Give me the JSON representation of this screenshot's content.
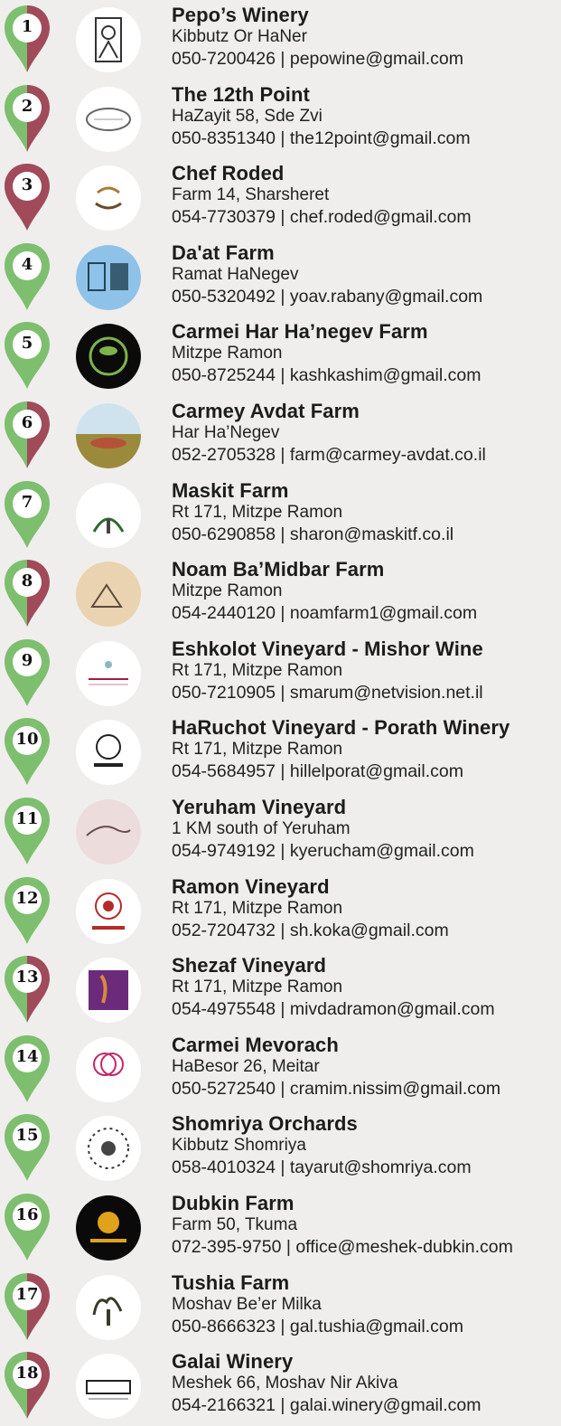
{
  "colors": {
    "pin_green": "#7dbf6e",
    "pin_red": "#a04a5a",
    "background": "#efeeec"
  },
  "entries": [
    {
      "number": "1",
      "name": "Pepo’s Winery",
      "address": "Kibbutz Or HaNer",
      "contact": "050-7200426 | pepowine@gmail.com",
      "pin": "split",
      "logo_icon": "pepos-winery-logo-icon"
    },
    {
      "number": "2",
      "name": "The 12th Point",
      "address": "HaZayit 58, Sde Zvi",
      "contact": "050-8351340 | the12point@gmail.com",
      "pin": "split",
      "logo_icon": "the-12th-point-logo-icon"
    },
    {
      "number": "3",
      "name": "Chef Roded",
      "address": "Farm 14, Sharsheret",
      "contact": "054-7730379 | chef.roded@gmail.com",
      "pin": "red",
      "logo_icon": "chef-roded-logo-icon"
    },
    {
      "number": "4",
      "name": "Da'at Farm",
      "address": "Ramat HaNegev",
      "contact": "050-5320492 | yoav.rabany@gmail.com",
      "pin": "green",
      "logo_icon": "daat-farm-logo-icon"
    },
    {
      "number": "5",
      "name": "Carmei Har Ha’negev Farm",
      "address": "Mitzpe Ramon",
      "contact": "050-8725244 | kashkashim@gmail.com",
      "pin": "green",
      "logo_icon": "carmei-har-hanegev-logo-icon"
    },
    {
      "number": "6",
      "name": "Carmey Avdat Farm",
      "address": "Har Ha’Negev",
      "contact": "052-2705328 | farm@carmey-avdat.co.il",
      "pin": "split",
      "logo_icon": "carmey-avdat-logo-icon"
    },
    {
      "number": "7",
      "name": "Maskit Farm",
      "address": "Rt 171, Mitzpe Ramon",
      "contact": "050-6290858 | sharon@maskitf.co.il",
      "pin": "green",
      "logo_icon": "maskit-farm-logo-icon"
    },
    {
      "number": "8",
      "name": "Noam Ba’Midbar Farm",
      "address": "Mitzpe Ramon",
      "contact": "054-2440120 | noamfarm1@gmail.com",
      "pin": "split",
      "logo_icon": "noam-bamidbar-logo-icon"
    },
    {
      "number": "9",
      "name": "Eshkolot Vineyard - Mishor Wine",
      "address": "Rt 171, Mitzpe Ramon",
      "contact": "050-7210905 | smarum@netvision.net.il",
      "pin": "green",
      "logo_icon": "eshkolot-vineyard-logo-icon"
    },
    {
      "number": "10",
      "name": "HaRuchot Vineyard - Porath Winery",
      "address": "Rt 171, Mitzpe Ramon",
      "contact": "054-5684957 | hillelporat@gmail.com",
      "pin": "green",
      "logo_icon": "porath-winery-logo-icon"
    },
    {
      "number": "11",
      "name": "Yeruham Vineyard",
      "address": "1 KM south of Yeruham",
      "contact": "054-9749192 | kyerucham@gmail.com",
      "pin": "green",
      "logo_icon": "yeruham-vineyard-logo-icon"
    },
    {
      "number": "12",
      "name": "Ramon Vineyard",
      "address": "Rt 171, Mitzpe Ramon",
      "contact": "052-7204732 | sh.koka@gmail.com",
      "pin": "green",
      "logo_icon": "ramon-vineyard-logo-icon"
    },
    {
      "number": "13",
      "name": "Shezaf Vineyard",
      "address": "Rt 171, Mitzpe Ramon",
      "contact": "054-4975548 | mivdadramon@gmail.com",
      "pin": "split",
      "logo_icon": "shezaf-vineyard-logo-icon"
    },
    {
      "number": "14",
      "name": "Carmei Mevorach",
      "address": "HaBesor 26, Meitar",
      "contact": "050-5272540 | cramim.nissim@gmail.com",
      "pin": "green",
      "logo_icon": "carmei-mevorach-logo-icon"
    },
    {
      "number": "15",
      "name": "Shomriya Orchards",
      "address": "Kibbutz Shomriya",
      "contact": "058-4010324 | tayarut@shomriya.com",
      "pin": "green",
      "logo_icon": "shomriya-orchards-logo-icon"
    },
    {
      "number": "16",
      "name": "Dubkin Farm",
      "address": "Farm 50, Tkuma",
      "contact": "072-395-9750 | office@meshek-dubkin.com",
      "pin": "green",
      "logo_icon": "dubkin-farm-logo-icon"
    },
    {
      "number": "17",
      "name": "Tushia Farm",
      "address": "Moshav Be’er Milka",
      "contact": "050-8666323 | gal.tushia@gmail.com",
      "pin": "split",
      "logo_icon": "tushia-farm-logo-icon"
    },
    {
      "number": "18",
      "name": "Galai Winery",
      "address": "Meshek 66, Moshav Nir Akiva",
      "contact": "054-2166321 | galai.winery@gmail.com",
      "pin": "split",
      "logo_icon": "galai-winery-logo-icon"
    }
  ]
}
